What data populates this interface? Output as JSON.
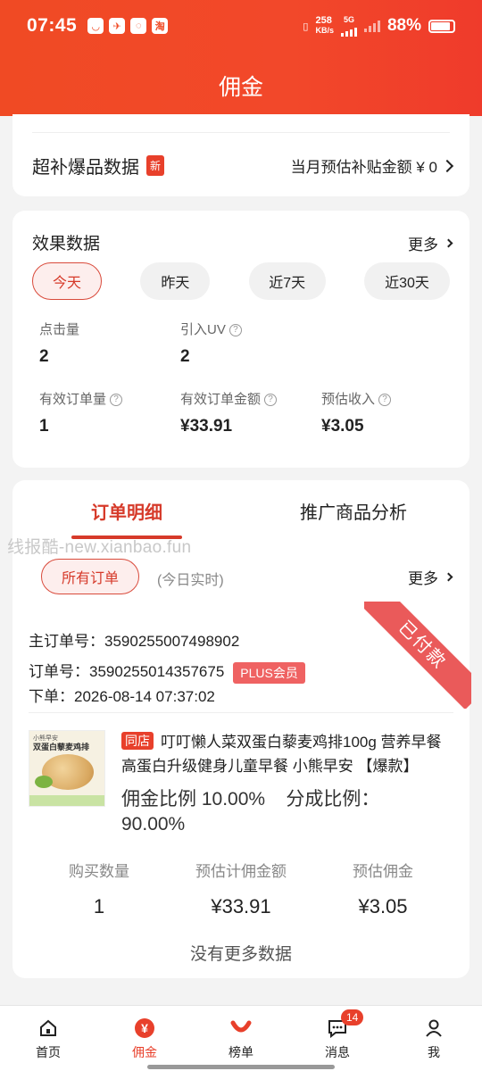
{
  "status_bar": {
    "time": "07:45",
    "app_icons": [
      "taobao-smile",
      "bird",
      "message",
      "淘"
    ],
    "net_speed_top": "258",
    "net_speed_unit": "KB/s",
    "network": "5G",
    "battery": "88%"
  },
  "header": {
    "title": "佣金"
  },
  "subsidy": {
    "label": "超补爆品数据",
    "badge": "新",
    "amount_text": "当月预估补贴金额 ¥ 0"
  },
  "effect": {
    "title": "效果数据",
    "more": "更多",
    "periods": [
      "今天",
      "昨天",
      "近7天",
      "近30天"
    ],
    "selected": "今天",
    "clicks_label": "点击量",
    "clicks": "2",
    "uv_label": "引入UV",
    "uv": "2",
    "orders_label": "有效订单量",
    "orders": "1",
    "order_amount_label": "有效订单金额",
    "order_amount": "¥33.91",
    "income_label": "预估收入",
    "income": "¥3.05"
  },
  "orders": {
    "tabs": [
      "订单明细",
      "推广商品分析"
    ],
    "watermark": "线报酷-new.xianbao.fun",
    "filter": "所有订单",
    "realtime": "(今日实时)",
    "more": "更多",
    "status_ribbon": "已付款",
    "main_order_label": "主订单号：",
    "main_order_no": "3590255007498902",
    "order_label": "订单号：",
    "order_no": "3590255014357675",
    "plus_badge": "PLUS会员",
    "time_label": "下单：",
    "order_time": "2026-08-14 07:37:02",
    "product": {
      "thumb_brand": "小熊早安",
      "thumb_name": "双蛋白藜麦鸡排",
      "shop_badge": "同店",
      "title": "叮叮懒人菜双蛋白藜麦鸡排100g 营养早餐 高蛋白升级健身儿童早餐 小熊早安 【爆款】",
      "commission_rate_label": "佣金比例",
      "commission_rate": "10.00%",
      "share_rate_label": "分成比例：",
      "share_rate": "90.00%"
    },
    "stats": [
      {
        "label": "购买数量",
        "value": "1"
      },
      {
        "label": "预估计佣金额",
        "value": "¥33.91"
      },
      {
        "label": "预估佣金",
        "value": "¥3.05"
      }
    ],
    "no_more": "没有更多数据"
  },
  "nav": {
    "items": [
      "首页",
      "佣金",
      "榜单",
      "消息",
      "我"
    ],
    "active": "佣金",
    "message_badge": "14"
  }
}
